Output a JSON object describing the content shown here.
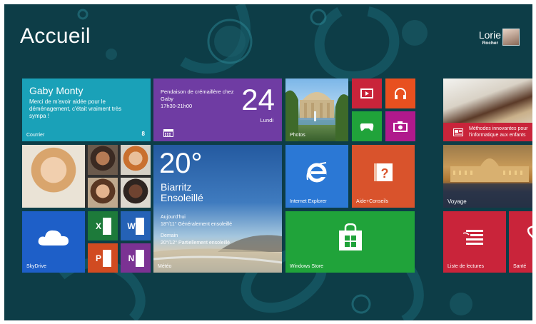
{
  "start": {
    "title": "Accueil"
  },
  "user": {
    "first_name": "Lorie",
    "last_name": "Rocher"
  },
  "colors": {
    "background": "#0d3d47",
    "mail_tile": "#1aa1b8",
    "calendar_tile": "#6f3ca3",
    "weather_tile": "#2a67a8",
    "ie_tile": "#2b78d5",
    "help_tile": "#d9532c",
    "store_tile": "#20a33a",
    "skydrive_tile": "#1e5fc8",
    "excel_tile": "#1d7a3a",
    "word_tile": "#2562b6",
    "powerpoint_tile": "#d14b21",
    "onenote_tile": "#7b3293",
    "reading_tile": "#c9243a",
    "health_tile": "#c9243a"
  },
  "tiles": {
    "mail": {
      "from": "Gaby Monty",
      "message": "Merci de m'avoir aidée pour le déménagement, c'était vraiment très sympa !",
      "name": "Courrier",
      "count": "8"
    },
    "calendar": {
      "event": "Pendaison de crémaillère chez Gaby",
      "time": "17h30-21h00",
      "day": "24",
      "weekday": "Lundi"
    },
    "weather": {
      "temperature": "20°",
      "city": "Biarritz",
      "condition": "Ensoleillé",
      "today_label": "Aujourd'hui",
      "today_forecast": "18°/11° Généralement ensoleillé",
      "tomorrow_label": "Demain",
      "tomorrow_forecast": "20°/12° Partiellement ensoleillé",
      "name": "Météo"
    },
    "photos": {
      "name": "Photos"
    },
    "ie": {
      "name": "Internet Explorer"
    },
    "help": {
      "name": "Aide+Conseils"
    },
    "store": {
      "name": "Windows Store"
    },
    "skydrive": {
      "name": "SkyDrive"
    },
    "excel": {
      "letter": "X"
    },
    "word": {
      "letter": "W"
    },
    "powerpoint": {
      "letter": "P"
    },
    "onenote": {
      "letter": "N"
    },
    "news": {
      "headline": "Méthodes innovantes pour l'informatique aux enfants"
    },
    "travel": {
      "name": "Voyage"
    },
    "reading": {
      "name": "Liste de lectures"
    },
    "health": {
      "name": "Santé"
    }
  },
  "icons": {
    "video": "video-icon",
    "music": "headphones-icon",
    "games": "gamepad-icon",
    "camera": "camera-icon"
  }
}
